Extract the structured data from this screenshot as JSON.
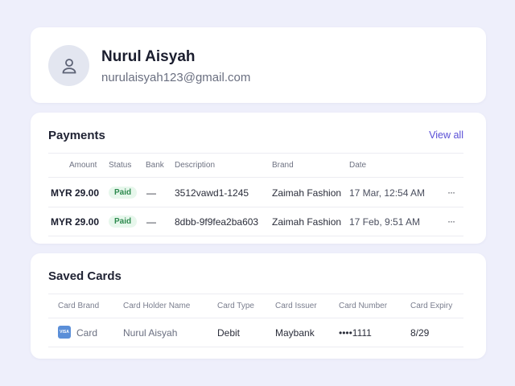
{
  "profile": {
    "name": "Nurul Aisyah",
    "email": "nurulaisyah123@gmail.com",
    "avatar_icon": "user-icon"
  },
  "payments": {
    "title": "Payments",
    "view_all": "View all",
    "columns": [
      "Amount",
      "Status",
      "Bank",
      "Description",
      "Brand",
      "Date"
    ],
    "rows": [
      {
        "amount": "MYR 29.00",
        "status": "Paid",
        "bank": "—",
        "description": "3512vawd1-1245",
        "brand": "Zaimah Fashion",
        "date": "17 Mar, 12:54 AM",
        "menu": "···"
      },
      {
        "amount": "MYR 29.00",
        "status": "Paid",
        "bank": "—",
        "description": "8dbb-9f9fea2ba603",
        "brand": "Zaimah Fashion",
        "date": "17 Feb, 9:51 AM",
        "menu": "···"
      }
    ]
  },
  "saved_cards": {
    "title": "Saved Cards",
    "columns": [
      "Card Brand",
      "Card Holder Name",
      "Card Type",
      "Card Issuer",
      "Card Number",
      "Card Expiry"
    ],
    "rows": [
      {
        "brand_icon": "visa-icon",
        "brand_icon_text": "VISA",
        "brand": "Card",
        "holder": "Nurul Aisyah",
        "type": "Debit",
        "issuer": "Maybank",
        "number": "••••1111",
        "expiry": "8/29"
      }
    ]
  },
  "colors": {
    "background": "#eeeffb",
    "accent": "#5a4fd6",
    "paid_text": "#2d8a4e",
    "paid_bg": "#e7f7ec",
    "visa": "#5b8fd8"
  }
}
